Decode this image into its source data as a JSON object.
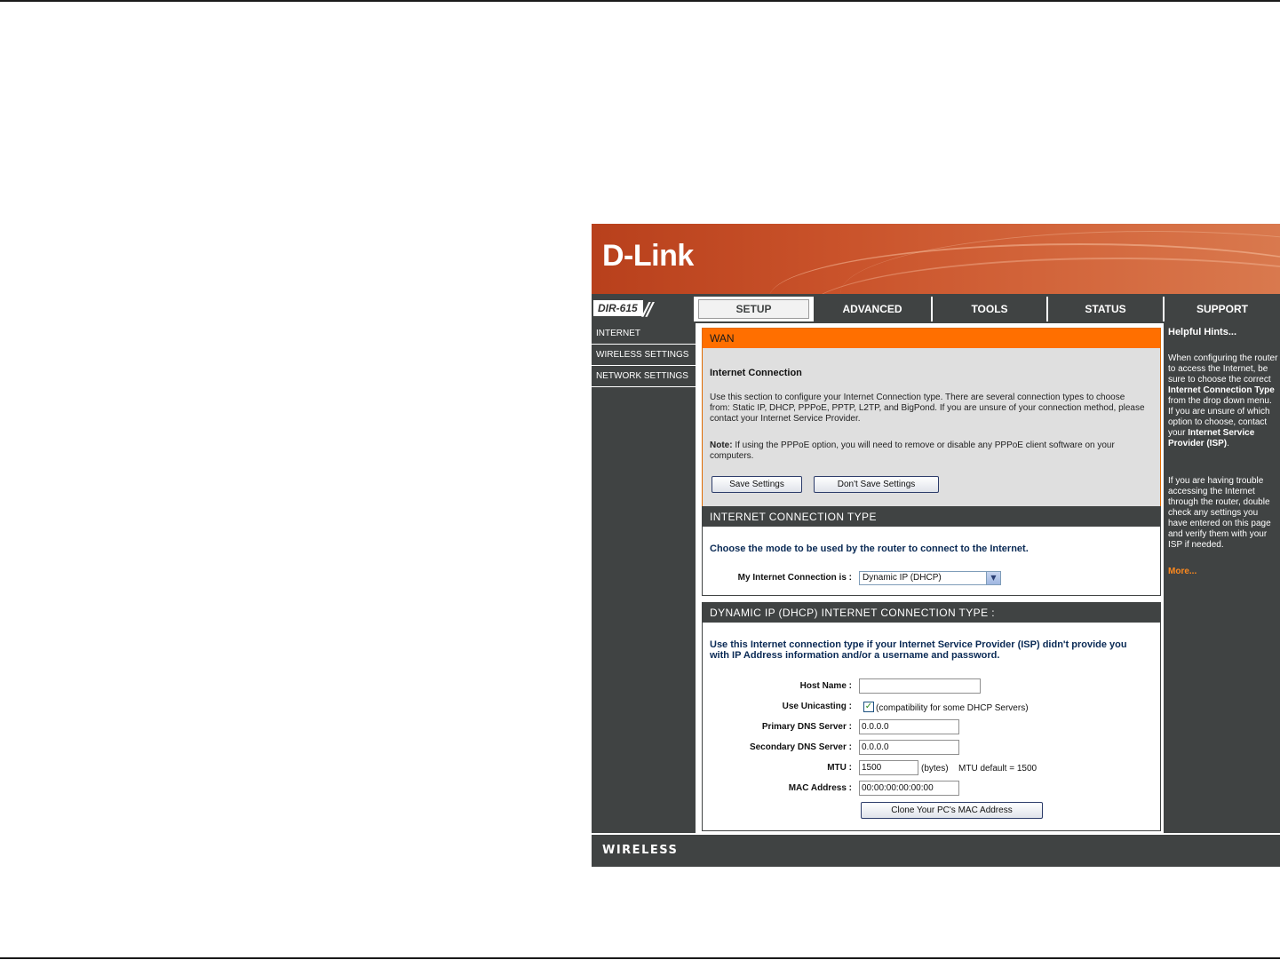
{
  "brand": {
    "logo": "D-Link",
    "model": "DIR-615",
    "footer": "WIRELESS"
  },
  "tabs": [
    {
      "label": "SETUP",
      "active": true
    },
    {
      "label": "ADVANCED",
      "active": false
    },
    {
      "label": "TOOLS",
      "active": false
    },
    {
      "label": "STATUS",
      "active": false
    },
    {
      "label": "SUPPORT",
      "active": false
    }
  ],
  "sidebar": {
    "items": [
      {
        "label": "INTERNET"
      },
      {
        "label": "WIRELESS SETTINGS"
      },
      {
        "label": "NETWORK SETTINGS"
      }
    ]
  },
  "wan": {
    "header": "WAN",
    "title": "Internet Connection",
    "desc_l1": "Use this section to configure your Internet Connection type. There are several connection types to choose",
    "desc_l2": "from: Static IP, DHCP, PPPoE, PPTP, L2TP, and BigPond. If you are unsure of your connection method, please",
    "desc_l3": "contact your Internet Service Provider.",
    "note_label": "Note:",
    "note_l1": " If using the PPPoE option, you will need to remove or disable any PPPoE client software on your",
    "note_l2": "computers.",
    "save_label": "Save Settings",
    "dont_save_label": "Don't Save Settings"
  },
  "ict": {
    "header": "INTERNET CONNECTION TYPE",
    "instruction": "Choose the mode to be used by the router to connect to the Internet.",
    "mode_label": "My Internet Connection is :",
    "mode_value": "Dynamic IP (DHCP)"
  },
  "dhcp": {
    "header": "DYNAMIC IP (DHCP) INTERNET CONNECTION TYPE :",
    "desc_l1": "Use this Internet connection type if your Internet Service Provider (ISP) didn't provide you",
    "desc_l2": "with IP Address information and/or a username and password.",
    "host_label": "Host Name :",
    "host_value": "",
    "unicast_label": "Use Unicasting :",
    "unicast_checked": true,
    "unicast_note": "(compatibility for some DHCP Servers)",
    "dns1_label": "Primary DNS Server :",
    "dns1_value": "0.0.0.0",
    "dns2_label": "Secondary DNS Server :",
    "dns2_value": "0.0.0.0",
    "mtu_label": "MTU :",
    "mtu_value": "1500",
    "mtu_unit": "(bytes)",
    "mtu_default": "MTU default = 1500",
    "mac_label": "MAC Address :",
    "mac_value": "00:00:00:00:00:00",
    "clone_label": "Clone Your PC's MAC Address"
  },
  "hints": {
    "title": "Helpful Hints...",
    "p1_a": "When configuring the router to access the Internet, be sure to choose the correct ",
    "p1_b": "Internet Connection Type",
    "p1_c": " from the drop down menu. If you are unsure of which option to choose, contact your ",
    "p1_d": "Internet Service Provider (ISP)",
    "p1_e": ".",
    "p2": "If you are having trouble accessing the Internet through the router, double check any settings you have entered on this page and verify them with your ISP if needed.",
    "more": "More..."
  },
  "colors": {
    "accent": "#ff6f00",
    "panel": "#404343",
    "link": "#ff8a1e"
  },
  "icons": {
    "select_arrow": "chevron-down-icon",
    "checkbox_mark": "check-icon"
  }
}
